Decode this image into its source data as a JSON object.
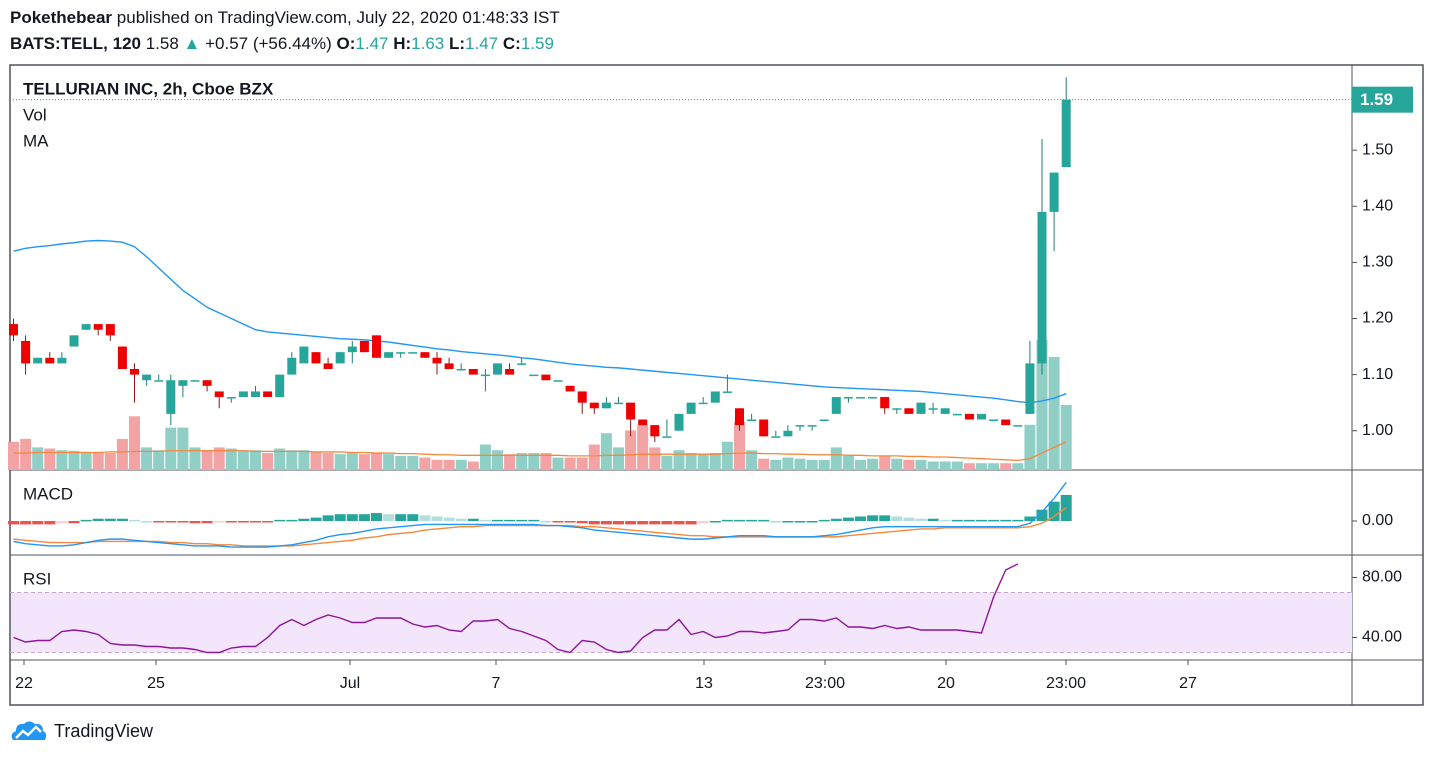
{
  "header": {
    "author": "Pokethebear",
    "published_text": "published on TradingView.com, July 22, 2020 01:48:33 IST",
    "symbol": "BATS:TELL, 120",
    "last": "1.58",
    "arrow": "▲",
    "change": "+0.57 (+56.44%)",
    "o_label": "O:",
    "o_value": "1.47",
    "h_label": "H:",
    "h_value": "1.63",
    "l_label": "L:",
    "l_value": "1.47",
    "c_label": "C:",
    "c_value": "1.59"
  },
  "footer": {
    "brand": "TradingView"
  },
  "colors": {
    "up": "#26a69a",
    "down": "#ef0000",
    "vol_up": "#8fcfc6",
    "vol_down": "#f3a3a3",
    "ma_long": "#2196f3",
    "ma_short": "#f5883a",
    "macd_line": "#2196f3",
    "signal_line": "#f5883a",
    "rsi_line": "#8e1599",
    "rsi_band": "#f3e5fb"
  },
  "chart_data": {
    "type": "candlestick",
    "title": "TELLURIAN INC, 2h, Cboe BZX",
    "indicator_labels": [
      "Vol",
      "MA"
    ],
    "last_price_label": "1.59",
    "price_axis": {
      "ticks": [
        "1.50",
        "1.40",
        "1.30",
        "1.20",
        "1.10",
        "1.00"
      ],
      "ylim": [
        0.93,
        1.65
      ]
    },
    "x_axis_ticks": [
      "22",
      "25",
      "Jul",
      "7",
      "13",
      "23:00",
      "20",
      "23:00",
      "27"
    ],
    "candles_ohlc": [
      [
        1.19,
        1.2,
        1.16,
        1.17
      ],
      [
        1.16,
        1.17,
        1.1,
        1.12
      ],
      [
        1.12,
        1.13,
        1.12,
        1.13
      ],
      [
        1.13,
        1.14,
        1.12,
        1.12
      ],
      [
        1.12,
        1.14,
        1.12,
        1.13
      ],
      [
        1.15,
        1.17,
        1.15,
        1.17
      ],
      [
        1.18,
        1.19,
        1.18,
        1.19
      ],
      [
        1.19,
        1.19,
        1.17,
        1.18
      ],
      [
        1.19,
        1.19,
        1.16,
        1.17
      ],
      [
        1.15,
        1.15,
        1.11,
        1.11
      ],
      [
        1.11,
        1.12,
        1.05,
        1.1
      ],
      [
        1.09,
        1.1,
        1.08,
        1.1
      ],
      [
        1.09,
        1.1,
        1.09,
        1.09
      ],
      [
        1.03,
        1.1,
        1.01,
        1.09
      ],
      [
        1.08,
        1.09,
        1.06,
        1.09
      ],
      [
        1.09,
        1.09,
        1.09,
        1.09
      ],
      [
        1.09,
        1.09,
        1.07,
        1.08
      ],
      [
        1.07,
        1.07,
        1.04,
        1.06
      ],
      [
        1.06,
        1.06,
        1.05,
        1.06
      ],
      [
        1.06,
        1.07,
        1.06,
        1.07
      ],
      [
        1.06,
        1.08,
        1.06,
        1.07
      ],
      [
        1.07,
        1.07,
        1.06,
        1.06
      ],
      [
        1.06,
        1.1,
        1.06,
        1.1
      ],
      [
        1.1,
        1.14,
        1.1,
        1.13
      ],
      [
        1.12,
        1.15,
        1.12,
        1.15
      ],
      [
        1.14,
        1.14,
        1.12,
        1.12
      ],
      [
        1.12,
        1.13,
        1.11,
        1.11
      ],
      [
        1.12,
        1.14,
        1.12,
        1.14
      ],
      [
        1.14,
        1.16,
        1.12,
        1.15
      ],
      [
        1.16,
        1.16,
        1.14,
        1.14
      ],
      [
        1.17,
        1.17,
        1.13,
        1.13
      ],
      [
        1.13,
        1.14,
        1.13,
        1.14
      ],
      [
        1.14,
        1.14,
        1.13,
        1.14
      ],
      [
        1.14,
        1.14,
        1.14,
        1.14
      ],
      [
        1.14,
        1.14,
        1.13,
        1.13
      ],
      [
        1.13,
        1.14,
        1.1,
        1.12
      ],
      [
        1.12,
        1.13,
        1.11,
        1.11
      ],
      [
        1.11,
        1.12,
        1.11,
        1.11
      ],
      [
        1.11,
        1.11,
        1.1,
        1.1
      ],
      [
        1.1,
        1.11,
        1.07,
        1.1
      ],
      [
        1.1,
        1.12,
        1.1,
        1.12
      ],
      [
        1.11,
        1.12,
        1.1,
        1.1
      ],
      [
        1.12,
        1.13,
        1.12,
        1.12
      ],
      [
        1.1,
        1.1,
        1.1,
        1.1
      ],
      [
        1.1,
        1.1,
        1.09,
        1.09
      ],
      [
        1.09,
        1.09,
        1.09,
        1.09
      ],
      [
        1.08,
        1.08,
        1.07,
        1.07
      ],
      [
        1.07,
        1.07,
        1.03,
        1.05
      ],
      [
        1.05,
        1.05,
        1.03,
        1.04
      ],
      [
        1.04,
        1.06,
        1.04,
        1.05
      ],
      [
        1.05,
        1.06,
        1.05,
        1.05
      ],
      [
        1.05,
        1.05,
        0.99,
        1.02
      ],
      [
        1.02,
        1.02,
        1.01,
        1.01
      ],
      [
        1.01,
        1.01,
        0.98,
        0.99
      ],
      [
        0.99,
        1.02,
        0.99,
        0.99
      ],
      [
        1.0,
        1.03,
        1.0,
        1.03
      ],
      [
        1.03,
        1.05,
        1.03,
        1.05
      ],
      [
        1.05,
        1.06,
        1.05,
        1.05
      ],
      [
        1.05,
        1.07,
        1.05,
        1.07
      ],
      [
        1.07,
        1.1,
        1.07,
        1.07
      ],
      [
        1.04,
        1.04,
        1.0,
        1.01
      ],
      [
        1.02,
        1.03,
        1.02,
        1.02
      ],
      [
        1.02,
        1.02,
        0.99,
        0.99
      ],
      [
        0.99,
        1.0,
        0.99,
        0.99
      ],
      [
        0.99,
        1.01,
        0.99,
        1.0
      ],
      [
        1.01,
        1.01,
        1.0,
        1.01
      ],
      [
        1.01,
        1.01,
        1.0,
        1.01
      ],
      [
        1.02,
        1.02,
        1.02,
        1.02
      ],
      [
        1.03,
        1.06,
        1.03,
        1.06
      ],
      [
        1.06,
        1.06,
        1.05,
        1.06
      ],
      [
        1.06,
        1.06,
        1.06,
        1.06
      ],
      [
        1.06,
        1.06,
        1.06,
        1.06
      ],
      [
        1.06,
        1.06,
        1.03,
        1.04
      ],
      [
        1.04,
        1.04,
        1.03,
        1.04
      ],
      [
        1.04,
        1.04,
        1.03,
        1.03
      ],
      [
        1.03,
        1.05,
        1.03,
        1.05
      ],
      [
        1.04,
        1.05,
        1.03,
        1.04
      ],
      [
        1.03,
        1.04,
        1.03,
        1.04
      ],
      [
        1.03,
        1.03,
        1.03,
        1.03
      ],
      [
        1.03,
        1.03,
        1.02,
        1.02
      ],
      [
        1.02,
        1.03,
        1.02,
        1.03
      ],
      [
        1.02,
        1.02,
        1.02,
        1.02
      ],
      [
        1.02,
        1.02,
        1.01,
        1.01
      ],
      [
        1.01,
        1.01,
        1.01,
        1.01
      ],
      [
        1.03,
        1.16,
        1.03,
        1.12
      ],
      [
        1.12,
        1.52,
        1.1,
        1.39
      ],
      [
        1.39,
        1.46,
        1.32,
        1.46
      ],
      [
        1.47,
        1.63,
        1.47,
        1.59
      ]
    ],
    "ma_long": [
      1.32,
      1.325,
      1.328,
      1.33,
      1.333,
      1.335,
      1.338,
      1.339,
      1.338,
      1.336,
      1.328,
      1.31,
      1.29,
      1.27,
      1.25,
      1.235,
      1.22,
      1.21,
      1.2,
      1.19,
      1.18,
      1.176,
      1.174,
      1.172,
      1.17,
      1.168,
      1.166,
      1.164,
      1.163,
      1.162,
      1.16,
      1.158,
      1.155,
      1.152,
      1.149,
      1.146,
      1.144,
      1.141,
      1.139,
      1.137,
      1.135,
      1.133,
      1.13,
      1.128,
      1.125,
      1.122,
      1.119,
      1.117,
      1.115,
      1.113,
      1.112,
      1.11,
      1.108,
      1.106,
      1.104,
      1.102,
      1.1,
      1.098,
      1.096,
      1.094,
      1.092,
      1.09,
      1.088,
      1.086,
      1.084,
      1.082,
      1.08,
      1.078,
      1.077,
      1.076,
      1.075,
      1.074,
      1.073,
      1.072,
      1.071,
      1.07,
      1.068,
      1.066,
      1.064,
      1.062,
      1.06,
      1.058,
      1.055,
      1.052,
      1.05,
      1.053,
      1.058,
      1.066
    ],
    "volume": [
      50,
      55,
      40,
      38,
      35,
      34,
      32,
      30,
      30,
      55,
      95,
      40,
      35,
      75,
      75,
      40,
      35,
      40,
      38,
      35,
      35,
      30,
      38,
      35,
      35,
      32,
      30,
      28,
      30,
      28,
      30,
      28,
      25,
      25,
      22,
      18,
      18,
      18,
      15,
      45,
      35,
      28,
      30,
      30,
      30,
      22,
      22,
      22,
      45,
      65,
      40,
      70,
      80,
      40,
      25,
      35,
      30,
      28,
      30,
      50,
      85,
      35,
      20,
      18,
      22,
      20,
      18,
      18,
      40,
      25,
      18,
      20,
      25,
      20,
      18,
      18,
      15,
      15,
      15,
      12,
      12,
      12,
      12,
      12,
      80,
      230,
      200,
      115
    ],
    "volume_ma": [
      30,
      30,
      31,
      31,
      31,
      31,
      31,
      31,
      32,
      32,
      33,
      33,
      33,
      34,
      34,
      34,
      34,
      34,
      34,
      34,
      33,
      33,
      33,
      33,
      33,
      32,
      32,
      32,
      31,
      31,
      30,
      30,
      29,
      29,
      28,
      27,
      27,
      26,
      26,
      26,
      26,
      26,
      26,
      26,
      26,
      26,
      25,
      25,
      25,
      26,
      26,
      27,
      28,
      28,
      28,
      28,
      28,
      28,
      28,
      29,
      30,
      30,
      29,
      29,
      28,
      28,
      27,
      27,
      27,
      26,
      26,
      25,
      25,
      25,
      24,
      24,
      23,
      23,
      22,
      21,
      20,
      19,
      18,
      17,
      20,
      30,
      40,
      50
    ],
    "macd": {
      "label": "MACD",
      "ticks": [
        "0.00"
      ],
      "ylim": [
        -0.03,
        0.045
      ],
      "macd_line": [
        -0.018,
        -0.02,
        -0.021,
        -0.022,
        -0.022,
        -0.021,
        -0.019,
        -0.017,
        -0.016,
        -0.016,
        -0.017,
        -0.018,
        -0.019,
        -0.02,
        -0.021,
        -0.022,
        -0.022,
        -0.022,
        -0.023,
        -0.023,
        -0.023,
        -0.023,
        -0.022,
        -0.021,
        -0.019,
        -0.017,
        -0.014,
        -0.012,
        -0.011,
        -0.009,
        -0.007,
        -0.006,
        -0.005,
        -0.004,
        -0.003,
        -0.003,
        -0.003,
        -0.003,
        -0.003,
        -0.003,
        -0.003,
        -0.003,
        -0.003,
        -0.003,
        -0.004,
        -0.004,
        -0.005,
        -0.006,
        -0.008,
        -0.009,
        -0.01,
        -0.011,
        -0.012,
        -0.013,
        -0.014,
        -0.015,
        -0.016,
        -0.016,
        -0.015,
        -0.014,
        -0.013,
        -0.013,
        -0.013,
        -0.014,
        -0.014,
        -0.014,
        -0.014,
        -0.013,
        -0.012,
        -0.01,
        -0.008,
        -0.006,
        -0.005,
        -0.005,
        -0.005,
        -0.005,
        -0.005,
        -0.005,
        -0.005,
        -0.005,
        -0.005,
        -0.005,
        -0.005,
        -0.005,
        -0.002,
        0.008,
        0.02,
        0.034
      ],
      "signal_line": [
        -0.016,
        -0.017,
        -0.018,
        -0.019,
        -0.019,
        -0.019,
        -0.019,
        -0.018,
        -0.018,
        -0.018,
        -0.018,
        -0.018,
        -0.018,
        -0.019,
        -0.019,
        -0.02,
        -0.02,
        -0.021,
        -0.021,
        -0.022,
        -0.022,
        -0.022,
        -0.022,
        -0.022,
        -0.021,
        -0.02,
        -0.019,
        -0.018,
        -0.017,
        -0.015,
        -0.014,
        -0.012,
        -0.011,
        -0.01,
        -0.008,
        -0.007,
        -0.006,
        -0.005,
        -0.005,
        -0.004,
        -0.004,
        -0.004,
        -0.004,
        -0.004,
        -0.004,
        -0.004,
        -0.004,
        -0.005,
        -0.005,
        -0.006,
        -0.007,
        -0.008,
        -0.009,
        -0.01,
        -0.011,
        -0.012,
        -0.013,
        -0.013,
        -0.014,
        -0.014,
        -0.014,
        -0.014,
        -0.014,
        -0.014,
        -0.014,
        -0.014,
        -0.014,
        -0.014,
        -0.014,
        -0.013,
        -0.012,
        -0.011,
        -0.01,
        -0.009,
        -0.008,
        -0.007,
        -0.007,
        -0.006,
        -0.006,
        -0.006,
        -0.006,
        -0.006,
        -0.006,
        -0.006,
        -0.005,
        -0.002,
        0.004,
        0.012
      ],
      "histogram": [
        -0.003,
        -0.003,
        -0.003,
        -0.003,
        -0.002,
        -0.002,
        0.001,
        0.002,
        0.002,
        0.002,
        0.001,
        0.0,
        -0.001,
        -0.001,
        -0.001,
        -0.002,
        -0.002,
        -0.001,
        -0.001,
        -0.001,
        -0.001,
        -0.001,
        0.001,
        0.001,
        0.002,
        0.003,
        0.005,
        0.006,
        0.006,
        0.006,
        0.007,
        0.006,
        0.006,
        0.006,
        0.005,
        0.004,
        0.003,
        0.002,
        0.002,
        0.001,
        0.001,
        0.001,
        0.001,
        0.001,
        0.0,
        -0.001,
        -0.001,
        -0.002,
        -0.003,
        -0.003,
        -0.003,
        -0.003,
        -0.003,
        -0.003,
        -0.003,
        -0.003,
        -0.003,
        -0.002,
        0.0,
        0.001,
        0.001,
        0.001,
        0.001,
        0.0,
        0.0,
        0.0,
        0.0,
        0.001,
        0.002,
        0.003,
        0.004,
        0.005,
        0.005,
        0.004,
        0.003,
        0.002,
        0.002,
        0.001,
        0.001,
        0.001,
        0.001,
        0.001,
        0.001,
        0.001,
        0.004,
        0.01,
        0.017,
        0.023
      ]
    },
    "rsi": {
      "label": "RSI",
      "ticks": [
        "80.00",
        "40.00"
      ],
      "ylim": [
        25,
        95
      ],
      "band": [
        30,
        70
      ],
      "values": [
        40,
        37,
        38,
        38,
        44,
        45,
        44,
        42,
        36,
        35,
        35,
        34,
        34,
        33,
        33,
        32,
        30,
        30,
        33,
        34,
        34,
        40,
        48,
        52,
        48,
        52,
        55,
        53,
        50,
        50,
        53,
        53,
        53,
        49,
        47,
        48,
        45,
        44,
        51,
        51,
        52,
        46,
        44,
        41,
        38,
        32,
        30,
        38,
        37,
        32,
        30,
        31,
        40,
        45,
        45,
        52,
        42,
        44,
        40,
        41,
        44,
        44,
        43,
        44,
        45,
        52,
        52,
        51,
        53,
        47,
        47,
        46,
        48,
        46,
        47,
        45,
        45,
        45,
        45,
        44,
        43,
        67,
        85,
        89
      ]
    }
  }
}
